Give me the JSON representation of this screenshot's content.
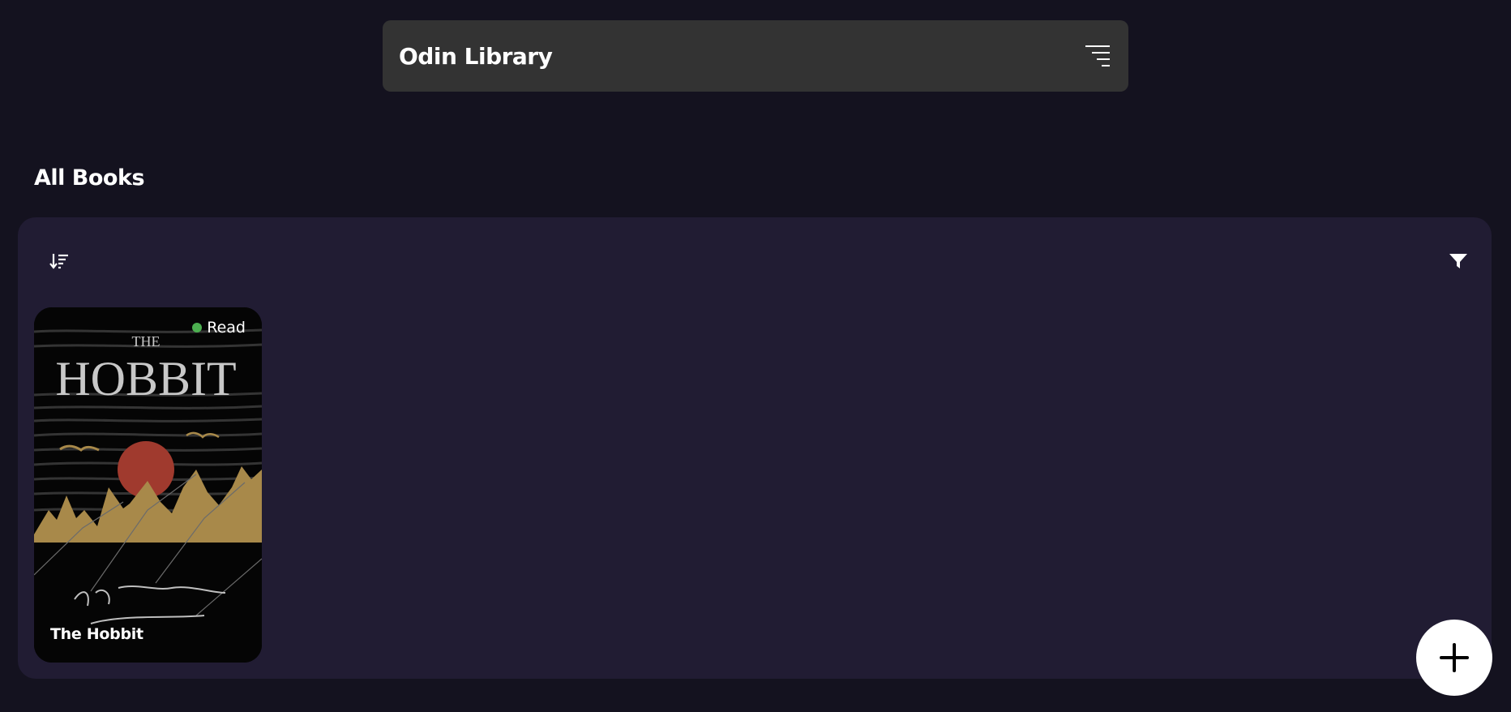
{
  "header": {
    "title": "Odin Library",
    "menu_icon": "menu-lines-icon"
  },
  "section": {
    "title": "All Books"
  },
  "toolbar": {
    "sort_icon": "sort-descending-icon",
    "filter_icon": "filter-icon"
  },
  "books": [
    {
      "title": "The Hobbit",
      "status": "Read",
      "status_color": "#4caf50",
      "cover": {
        "line1": "THE",
        "line2": "HOBBIT"
      }
    }
  ],
  "fab": {
    "icon": "plus-icon"
  },
  "colors": {
    "background": "#14121f",
    "header": "#333333",
    "panel": "#211c33",
    "cover_gold": "#a8894a",
    "cover_sun": "#a03a2e"
  }
}
